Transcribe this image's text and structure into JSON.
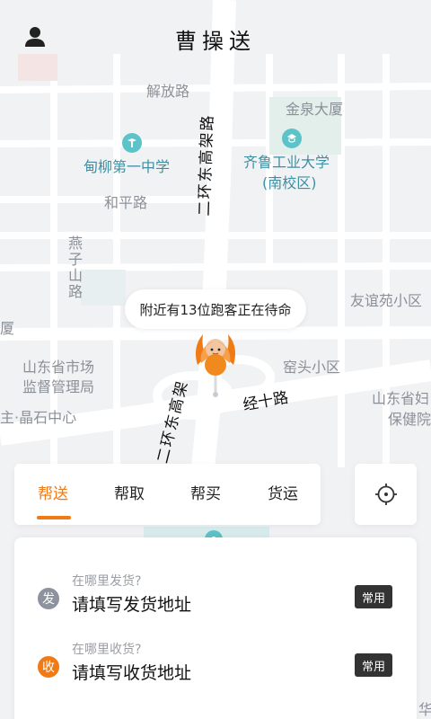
{
  "app": {
    "title": "曹操送"
  },
  "map": {
    "labels": {
      "jiefang_road": "解放路",
      "jinquan_mansion": "金泉大厦",
      "dianliu_school": "甸柳第一中学",
      "qilu_univ": "齐鲁工业大学",
      "qilu_univ_south": "(南校区)",
      "heping_road": "和平路",
      "erhuan_east_elevated": "二环东高架路",
      "yanzishan_road": "燕子山路",
      "youyiyuan": "友谊苑小区",
      "xia": "厦",
      "shandong_market": "山东省市场",
      "supervision_bureau": "监督管理局",
      "yaotou": "窑头小区",
      "jingshi_road": "经十路",
      "shandong_health_1": "山东省妇",
      "shandong_health_2": "保健院",
      "jingshi_center": "主·晶石中心",
      "erhuan_east_elevated_2": "二环东高架",
      "bottom_hua": "华"
    }
  },
  "rider": {
    "nearby_text": "附近有13位跑客正在待命"
  },
  "tabs": [
    {
      "label": "帮送"
    },
    {
      "label": "帮取"
    },
    {
      "label": "帮买"
    },
    {
      "label": "货运"
    }
  ],
  "address": {
    "send": {
      "badge": "发",
      "hint": "在哪里发货?",
      "placeholder": "请填写发货地址",
      "common": "常用"
    },
    "receive": {
      "badge": "收",
      "hint": "在哪里收货?",
      "placeholder": "请填写收货地址",
      "common": "常用"
    }
  },
  "colors": {
    "accent": "#f07a14",
    "poi": "#5cc3c9"
  },
  "icons": {
    "user": "user-icon",
    "locate": "crosshair-icon",
    "poi": "school-icon"
  }
}
